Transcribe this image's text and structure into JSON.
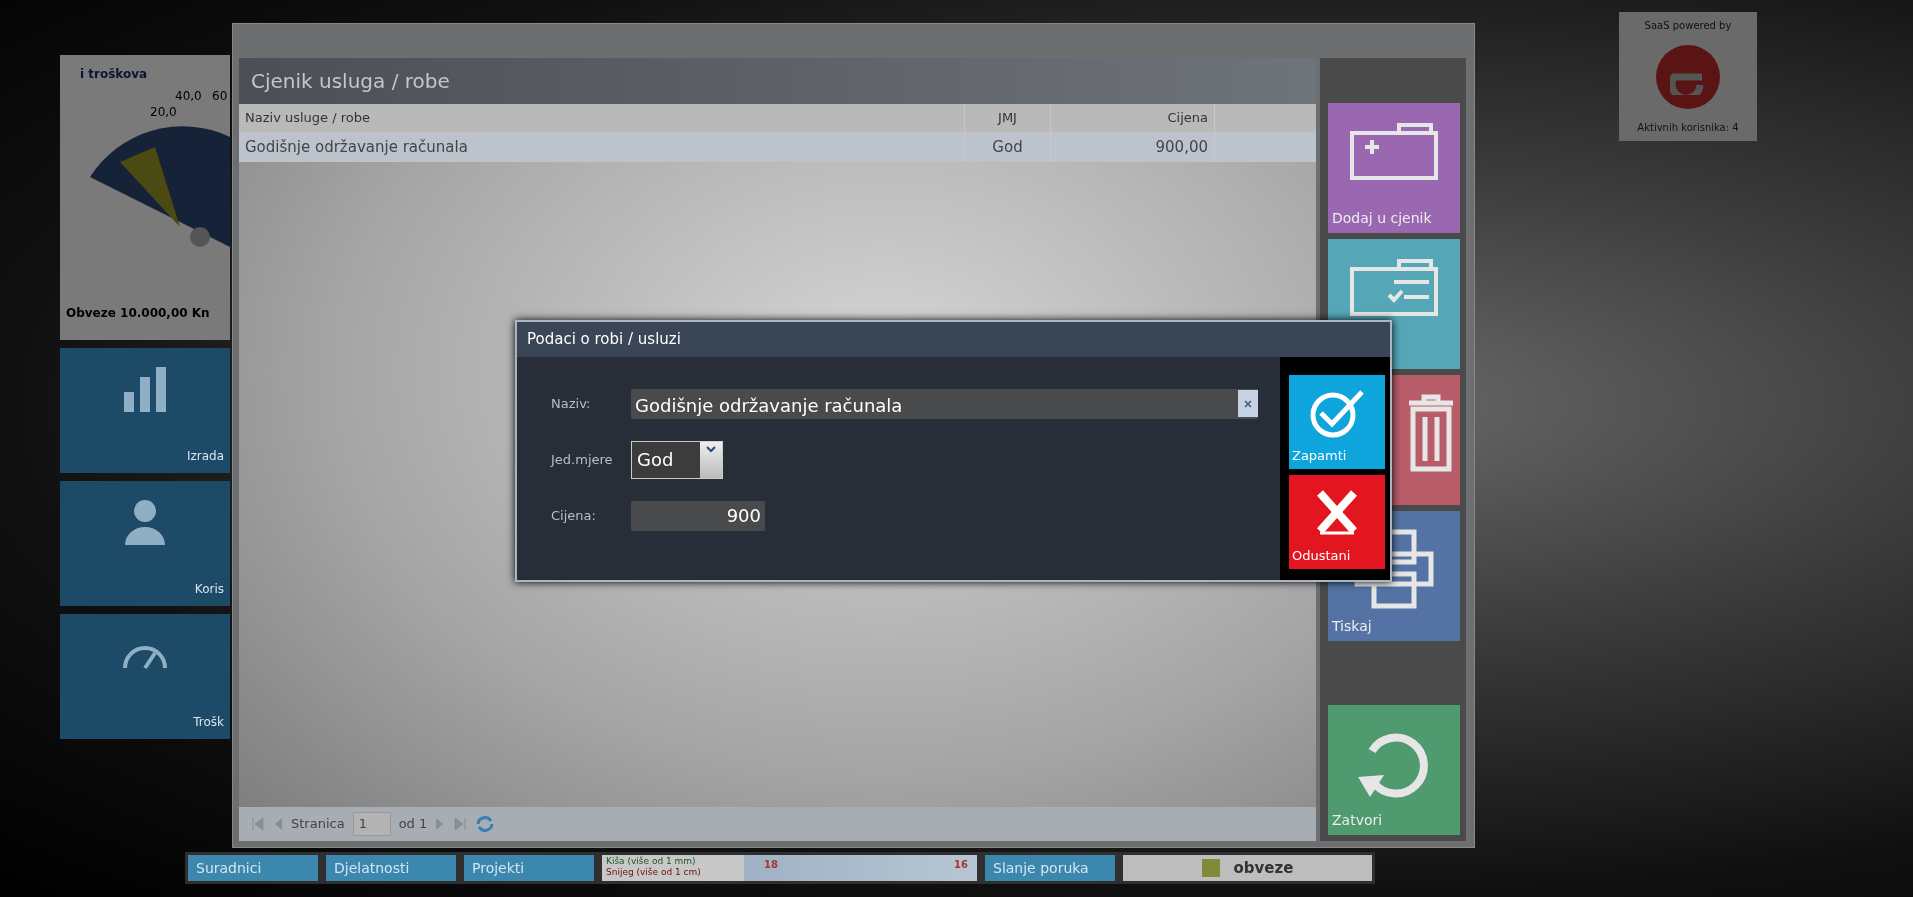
{
  "background_dashboard": {
    "chart_title": "i troškova",
    "gauge_ticks": [
      "20,0",
      "40,0",
      "60"
    ],
    "gauge_caption": "Obveze 10.000,00 Kn",
    "tiles": [
      {
        "label": "Izrada",
        "kind": "chart"
      },
      {
        "label": "Koris",
        "kind": "users"
      },
      {
        "label": "Trošk",
        "kind": "gauge"
      }
    ]
  },
  "logo_panel": {
    "caption": "SaaS powered by",
    "users": "Aktivnih korisnika: 4"
  },
  "window": {
    "title": "Cjenik usluga / robe"
  },
  "table": {
    "columns": [
      "Naziv usluge / robe",
      "JMJ",
      "Cijena"
    ],
    "rows": [
      {
        "cells": [
          "Godišnje održavanje računala",
          "God",
          "900,00"
        ],
        "selected": true
      }
    ]
  },
  "pager": {
    "label": "Stranica",
    "page": "1",
    "of": "od 1"
  },
  "side_tiles": [
    {
      "kind": "add",
      "label": "Dodaj u cjenik",
      "color": "#9a68b0"
    },
    {
      "kind": "list",
      "color": "#55a7b7"
    },
    {
      "kind": "trash",
      "color": "#b85c6a"
    },
    {
      "kind": "print",
      "label": "Tiskaj",
      "color": "#5473a4"
    },
    {
      "kind": "close",
      "label": "Zatvori",
      "color": "#4f9a6e"
    }
  ],
  "dialog": {
    "title": "Podaci o robi / usluzi",
    "fields": [
      {
        "kind": "text",
        "label": "Naziv:",
        "value": "Godišnje održavanje računala"
      },
      {
        "kind": "select",
        "label": "Jed.mjere",
        "value": "God"
      },
      {
        "kind": "number",
        "label": "Cijena:",
        "value": "900"
      }
    ],
    "buttons": [
      {
        "kind": "save",
        "label": "Zapamti"
      },
      {
        "kind": "cancel",
        "label": "Odustani"
      }
    ]
  },
  "taskbar": [
    {
      "kind": "tile",
      "label": "Suradnici"
    },
    {
      "kind": "tile",
      "label": "Djelatnosti"
    },
    {
      "kind": "tile",
      "label": "Projekti"
    },
    {
      "kind": "weather",
      "legend": [
        "Kiša (više od 1 mm)",
        "Snijeg (više od 1 cm)"
      ],
      "temps": [
        "18",
        "16"
      ]
    },
    {
      "kind": "tile",
      "label": "Slanje poruka"
    },
    {
      "kind": "legend",
      "label": "obveze"
    }
  ]
}
